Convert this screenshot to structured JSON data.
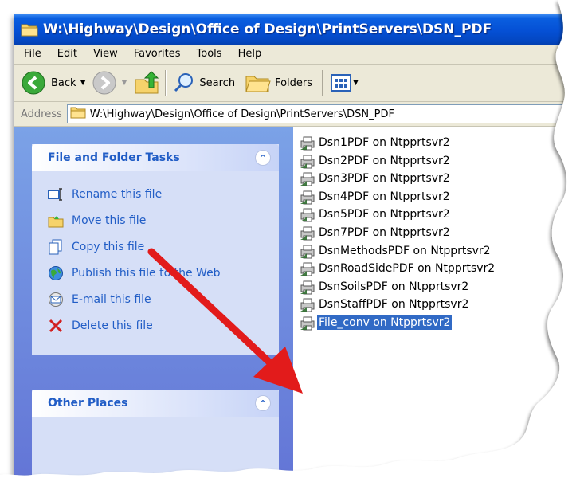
{
  "window": {
    "title": "W:\\Highway\\Design\\Office of Design\\PrintServers\\DSN_PDF"
  },
  "menu": [
    "File",
    "Edit",
    "View",
    "Favorites",
    "Tools",
    "Help"
  ],
  "toolbar": {
    "back_label": "Back",
    "search_label": "Search",
    "folders_label": "Folders"
  },
  "address": {
    "label": "Address",
    "value": "W:\\Highway\\Design\\Office of Design\\PrintServers\\DSN_PDF"
  },
  "tasks_panel": {
    "title": "File and Folder Tasks",
    "items": [
      {
        "label": "Rename this file",
        "icon": "rename-icon"
      },
      {
        "label": "Move this file",
        "icon": "move-icon"
      },
      {
        "label": "Copy this file",
        "icon": "copy-icon"
      },
      {
        "label": "Publish this file to the Web",
        "icon": "globe-icon"
      },
      {
        "label": "E-mail this file",
        "icon": "email-icon"
      },
      {
        "label": "Delete this file",
        "icon": "delete-icon"
      }
    ]
  },
  "other_places": {
    "title": "Other Places"
  },
  "files": [
    {
      "name": "Dsn1PDF on Ntpprtsvr2",
      "selected": false
    },
    {
      "name": "Dsn2PDF on Ntpprtsvr2",
      "selected": false
    },
    {
      "name": "Dsn3PDF on Ntpprtsvr2",
      "selected": false
    },
    {
      "name": "Dsn4PDF on Ntpprtsvr2",
      "selected": false
    },
    {
      "name": "Dsn5PDF on Ntpprtsvr2",
      "selected": false
    },
    {
      "name": "Dsn7PDF on Ntpprtsvr2",
      "selected": false
    },
    {
      "name": "DsnMethodsPDF on Ntpprtsvr2",
      "selected": false
    },
    {
      "name": "DsnRoadSidePDF on Ntpprtsvr2",
      "selected": false
    },
    {
      "name": "DsnSoilsPDF on Ntpprtsvr2",
      "selected": false
    },
    {
      "name": "DsnStaffPDF on Ntpprtsvr2",
      "selected": false
    },
    {
      "name": "File_conv on Ntpprtsvr2",
      "selected": true
    }
  ],
  "colors": {
    "title_bar": "#0550d5",
    "task_pane": "#6f8ddf",
    "task_link": "#215dc6",
    "selection": "#316ac5",
    "annotation_arrow": "#e21b1b"
  }
}
